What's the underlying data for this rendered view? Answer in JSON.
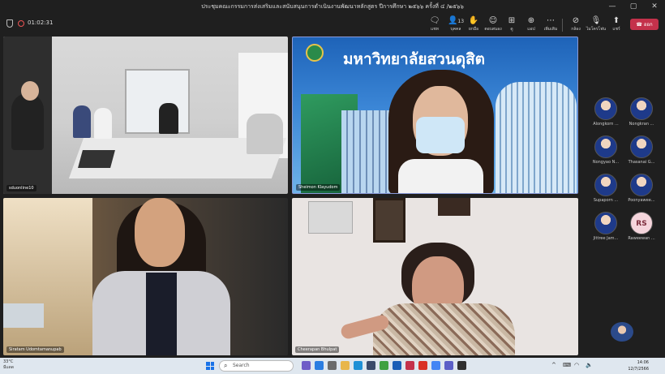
{
  "window": {
    "title": "ประชุมคณะกรรมการส่งเสริมและสนับสนุนการดำเนินงานพัฒนาหลักสูตร ปีการศึกษา ๒๕๖๖ ครั้งที่ ๔ /๒๕๖๖",
    "minimize": "—",
    "maximize": "▢",
    "close": "✕"
  },
  "meeting": {
    "timer": "01:02:31"
  },
  "toolbar": {
    "chat": {
      "label": "แชท",
      "icon": "chat-icon"
    },
    "people": {
      "label": "บุคคล",
      "count": "13",
      "icon": "people-icon"
    },
    "raise": {
      "label": "ยกมือ",
      "icon": "hand-icon"
    },
    "react": {
      "label": "ตอบสนอง",
      "icon": "smile-icon"
    },
    "view": {
      "label": "ดู",
      "icon": "grid-icon"
    },
    "apps": {
      "label": "แอป",
      "icon": "plus-icon"
    },
    "more": {
      "label": "เพิ่มเติม",
      "icon": "more-icon"
    },
    "camera": {
      "label": "กล้อง",
      "icon": "camera-off-icon"
    },
    "mic": {
      "label": "ไมโครโฟน",
      "icon": "mic-icon"
    },
    "share": {
      "label": "แชร์",
      "icon": "share-icon"
    },
    "leave": {
      "label": "ออก",
      "icon": "phone-icon"
    }
  },
  "video_tiles": [
    {
      "name": "sduonline10"
    },
    {
      "name": "Sheimon Klayudom",
      "banner": "มหาวิทยาลัยสวนดุสิต"
    },
    {
      "name": "Siratam Udomtamanupab"
    },
    {
      "name": "Cheerapan Bhulpat"
    }
  ],
  "roster": [
    {
      "name": "Alongkorn ..."
    },
    {
      "name": "Nongkran ..."
    },
    {
      "name": "Nongyao N..."
    },
    {
      "name": "Thasanai G..."
    },
    {
      "name": "Supaporn ..."
    },
    {
      "name": "Poonyawee..."
    },
    {
      "name": "Jittree Jam..."
    },
    {
      "name": "Raweewan ...",
      "initials": "RS"
    }
  ],
  "taskbar": {
    "weather_temp": "33°C",
    "weather_text": "มีแดด",
    "search_placeholder": "Search",
    "time": "14:06",
    "date": "12/7/2566",
    "colors": {
      "accent": "#1a73e8",
      "leave": "#c4314b",
      "taskbar": "#dfe7ef"
    }
  }
}
